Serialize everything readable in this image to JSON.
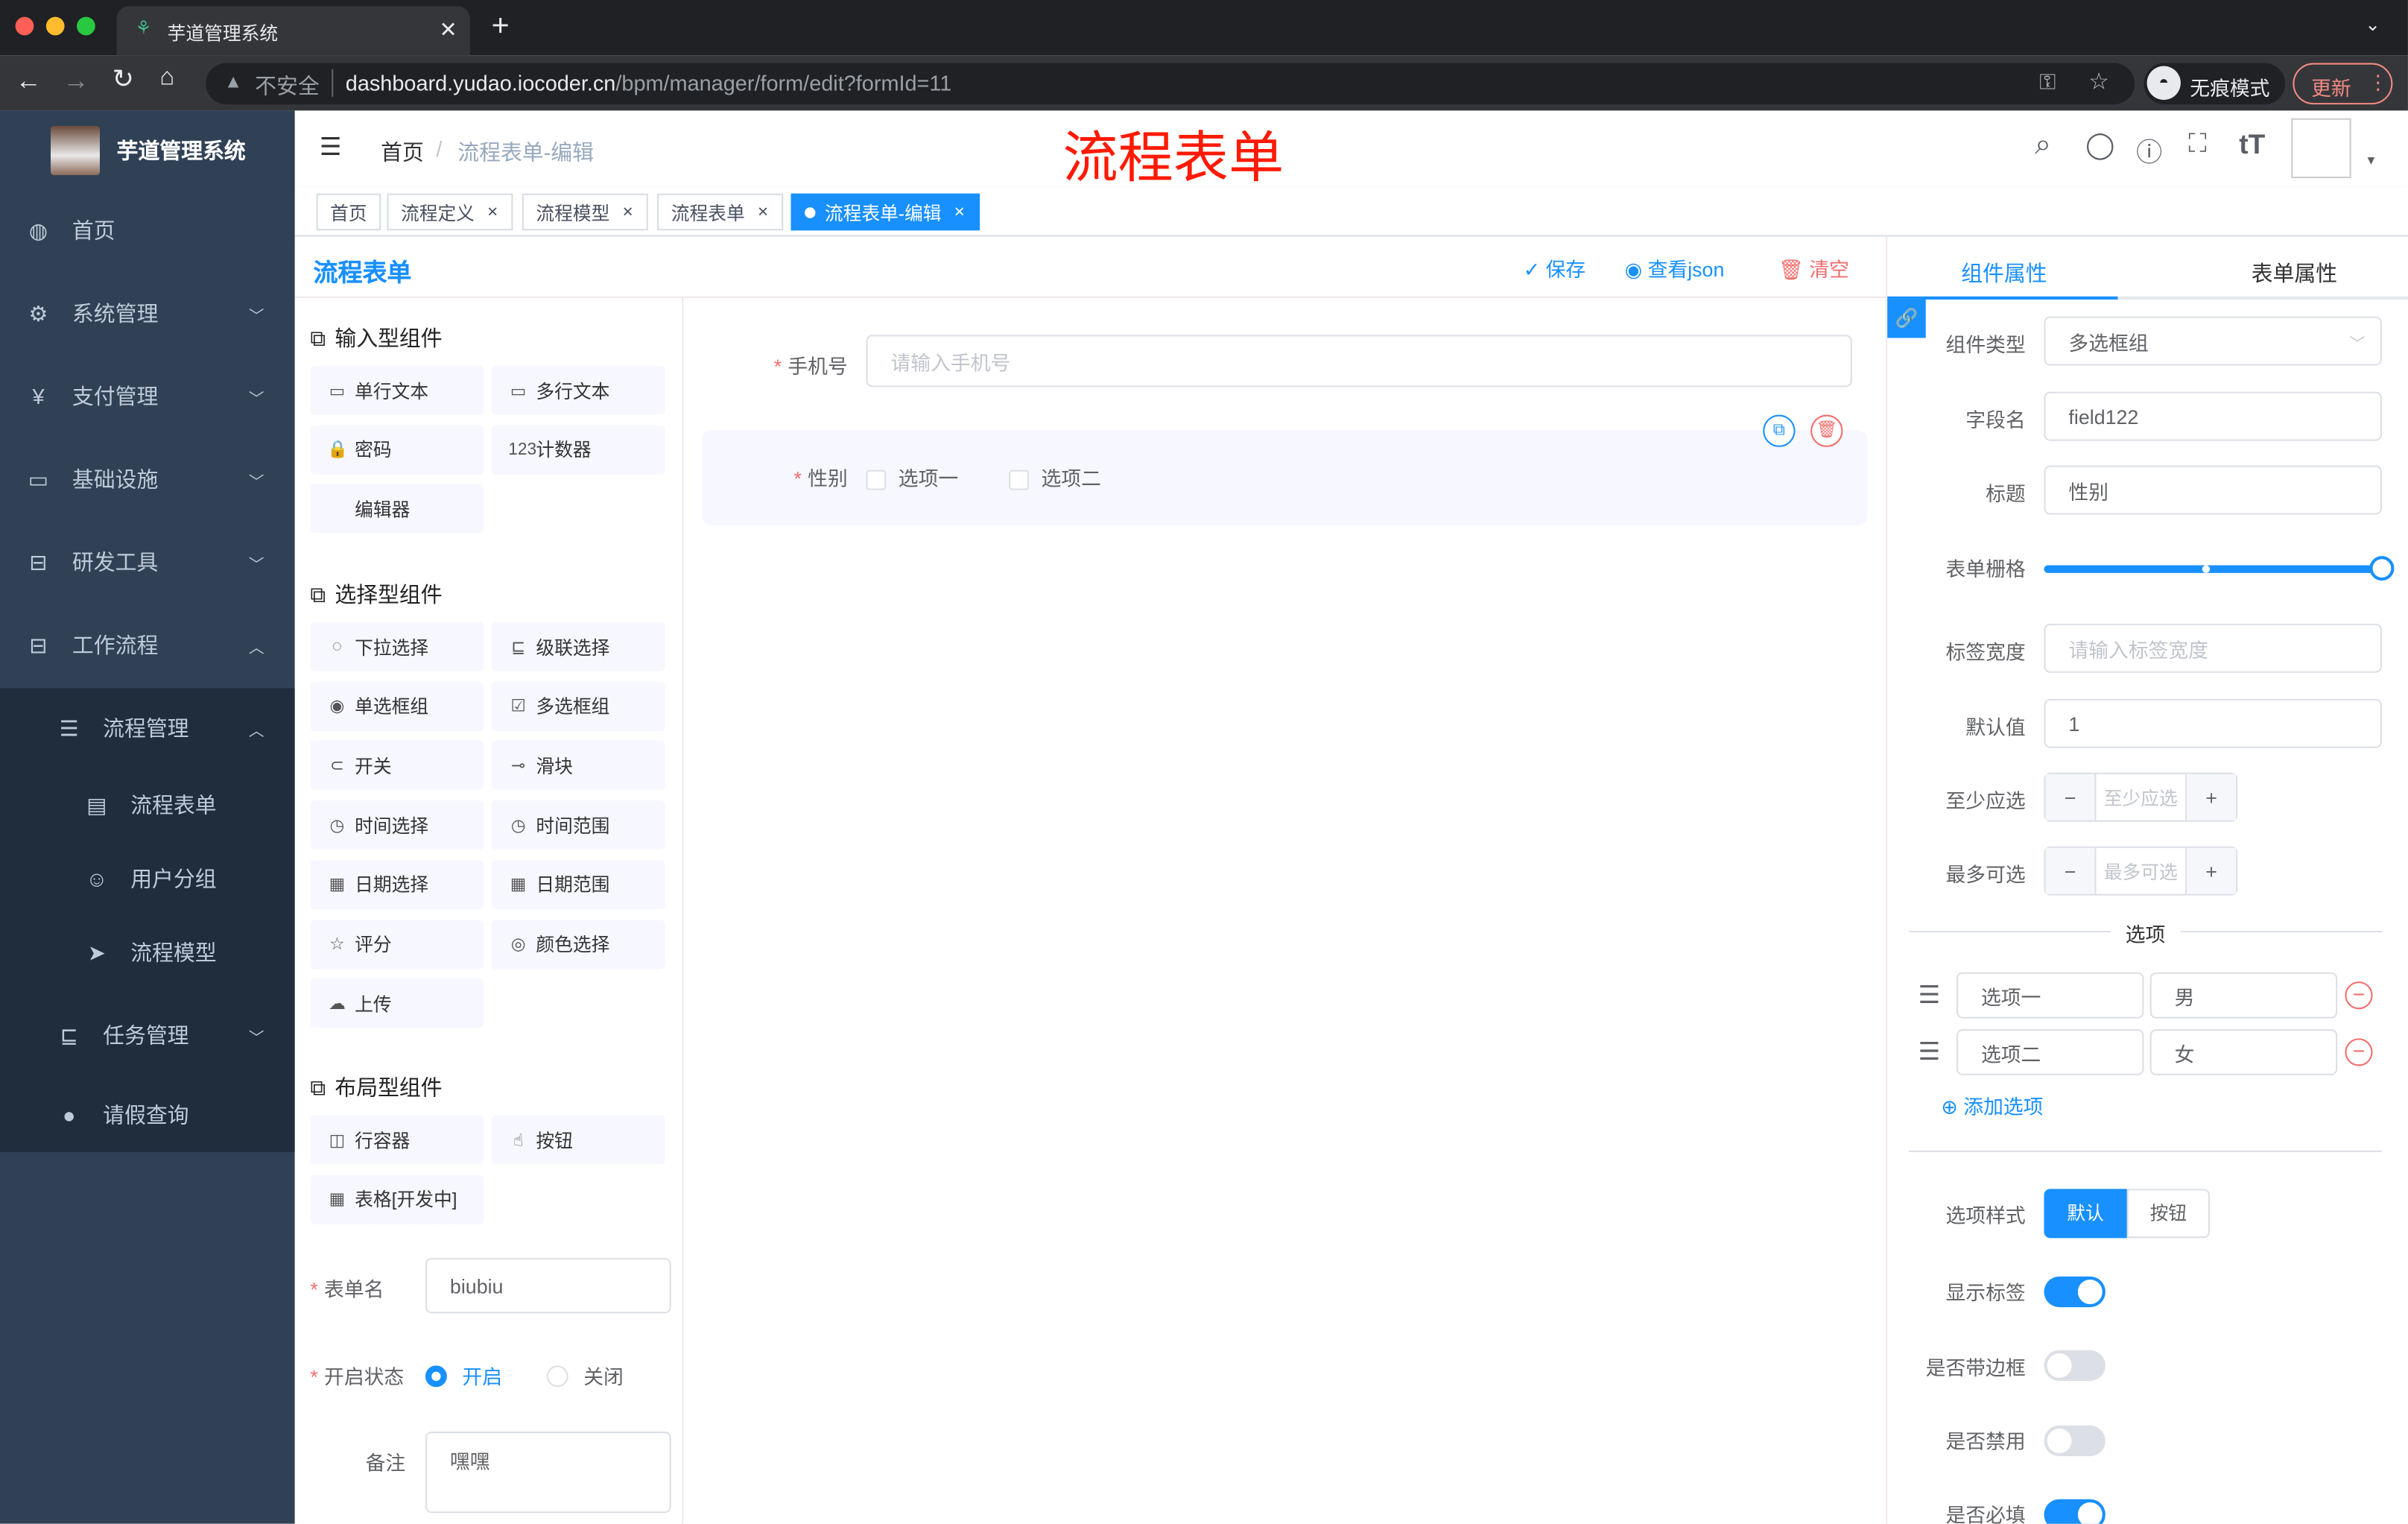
{
  "browser": {
    "tab_title": "芋道管理系统",
    "insecure_label": "不安全",
    "url_host": "dashboard.yudao.iocoder.cn",
    "url_path": "/bpm/manager/form/edit?formId=11",
    "incognito_label": "无痕模式",
    "update_label": "更新"
  },
  "sidebar": {
    "logo_title": "芋道管理系统",
    "items": [
      {
        "label": "首页",
        "icon": "dashboard-icon"
      },
      {
        "label": "系统管理",
        "icon": "gear-icon"
      },
      {
        "label": "支付管理",
        "icon": "yen-icon"
      },
      {
        "label": "基础设施",
        "icon": "monitor-icon"
      },
      {
        "label": "研发工具",
        "icon": "toolbox-icon"
      },
      {
        "label": "工作流程",
        "icon": "toolbox-icon"
      },
      {
        "label": "流程管理",
        "icon": "tree-icon"
      },
      {
        "label": "流程表单",
        "icon": "form-icon"
      },
      {
        "label": "用户分组",
        "icon": "peoples-icon"
      },
      {
        "label": "流程模型",
        "icon": "send-icon"
      },
      {
        "label": "任务管理",
        "icon": "task-icon"
      },
      {
        "label": "请假查询",
        "icon": "user-icon"
      }
    ]
  },
  "navbar": {
    "breadcrumb": [
      "首页",
      "流程表单-编辑"
    ],
    "big_title": "流程表单"
  },
  "tags": [
    {
      "label": "首页"
    },
    {
      "label": "流程定义"
    },
    {
      "label": "流程模型"
    },
    {
      "label": "流程表单"
    },
    {
      "label": "流程表单-编辑",
      "active": true
    }
  ],
  "palette": {
    "title": "流程表单",
    "groups": [
      {
        "title": "输入型组件",
        "items": [
          "单行文本",
          "多行文本",
          "密码",
          "计数器",
          "编辑器"
        ]
      },
      {
        "title": "选择型组件",
        "items": [
          "下拉选择",
          "级联选择",
          "单选框组",
          "多选框组",
          "开关",
          "滑块",
          "时间选择",
          "时间范围",
          "日期选择",
          "日期范围",
          "评分",
          "颜色选择",
          "上传"
        ]
      },
      {
        "title": "布局型组件",
        "items": [
          "行容器",
          "按钮",
          "表格[开发中]"
        ]
      }
    ],
    "form_name_label": "表单名",
    "form_name_value": "biubiu",
    "status_label": "开启状态",
    "status_options": [
      "开启",
      "关闭"
    ],
    "status_value": "开启",
    "remark_label": "备注",
    "remark_value": "嘿嘿"
  },
  "toolbar": {
    "save": "保存",
    "view_json": "查看json",
    "clear": "清空"
  },
  "canvas": {
    "phone_label": "手机号",
    "phone_placeholder": "请输入手机号",
    "gender_label": "性别",
    "gender_options": [
      "选项一",
      "选项二"
    ]
  },
  "props": {
    "tabs": [
      "组件属性",
      "表单属性"
    ],
    "active_tab": "组件属性",
    "type_label": "组件类型",
    "type_value": "多选框组",
    "field_label": "字段名",
    "field_value": "field122",
    "title_label": "标题",
    "title_value": "性别",
    "grid_label": "表单栅格",
    "grid_value": 24,
    "label_width_label": "标签宽度",
    "label_width_placeholder": "请输入标签宽度",
    "default_label": "默认值",
    "default_value": "1",
    "min_label": "至少应选",
    "min_placeholder": "至少应选",
    "max_label": "最多可选",
    "max_placeholder": "最多可选",
    "options_divider": "选项",
    "options": [
      {
        "label": "选项一",
        "value": "男"
      },
      {
        "label": "选项二",
        "value": "女"
      }
    ],
    "add_option": "添加选项",
    "style_label": "选项样式",
    "style_options": [
      "默认",
      "按钮"
    ],
    "style_value": "默认",
    "show_label_label": "显示标签",
    "show_label": true,
    "border_label": "是否带边框",
    "border": false,
    "disabled_label": "是否禁用",
    "disabled": false,
    "required_label": "是否必填",
    "required": true
  }
}
